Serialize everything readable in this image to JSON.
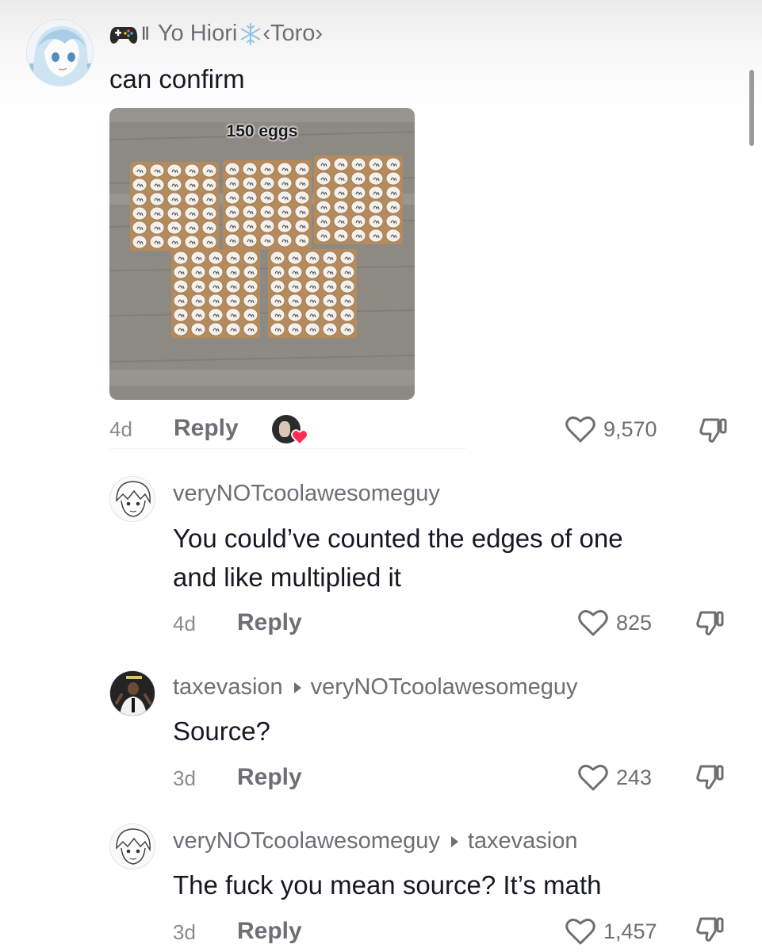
{
  "comments": [
    {
      "username": "Yo Hiori",
      "tag": "‹Toro›",
      "text_lines": [
        "can confirm"
      ],
      "time": "4d",
      "reply_label": "Reply",
      "likes": "9,570",
      "attachment_caption": "150 eggs"
    },
    {
      "username": "veryNOTcoolawesomeguy",
      "text_lines": [
        "You could’ve counted the edges of one",
        "and like multiplied it"
      ],
      "time": "4d",
      "reply_label": "Reply",
      "likes": "825"
    },
    {
      "username": "taxevasion",
      "replying_to": "veryNOTcoolawesomeguy",
      "text_lines": [
        "Source?"
      ],
      "time": "3d",
      "reply_label": "Reply",
      "likes": "243"
    },
    {
      "username": "veryNOTcoolawesomeguy",
      "replying_to": "taxevasion",
      "text_lines": [
        "The fuck you mean source? It’s math"
      ],
      "time": "3d",
      "reply_label": "Reply",
      "likes": "1,457"
    }
  ],
  "icons": {
    "like": "heart-outline-icon",
    "dislike": "thumbs-down-icon",
    "creator_liked": "creator-liked-heart-icon",
    "controller": "gamepad-icon",
    "snowflake": "snowflake-icon"
  },
  "colors": {
    "primary_text": "#161823",
    "secondary_text": "#6e6e73",
    "creator_heart": "#fe2c55"
  }
}
